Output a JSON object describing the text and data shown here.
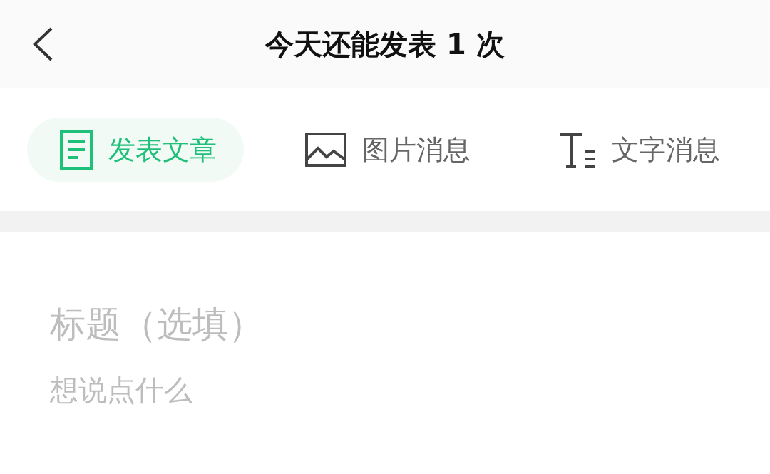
{
  "header": {
    "title": "今天还能发表 1 次"
  },
  "tabs": [
    {
      "label": "发表文章",
      "kind": "article",
      "selected": true
    },
    {
      "label": "图片消息",
      "kind": "image",
      "selected": false
    },
    {
      "label": "文字消息",
      "kind": "text",
      "selected": false
    }
  ],
  "form": {
    "title_placeholder": "标题（选填）",
    "body_placeholder": "想说点什么"
  }
}
